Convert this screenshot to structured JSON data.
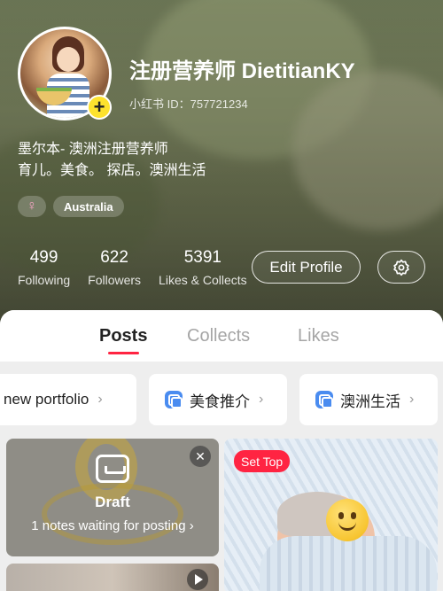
{
  "profile": {
    "nickname": "注册营养师 DietitianKY",
    "user_id": "小红书 ID：757721234",
    "bio_line1": "墨尔本- 澳洲注册营养师",
    "bio_line2": "育儿。美食。 探店。澳洲生活",
    "gender_icon": "♀",
    "location_tag": "Australia",
    "plus_icon": "+"
  },
  "stats": [
    {
      "value": "499",
      "label": "Following"
    },
    {
      "value": "622",
      "label": "Followers"
    },
    {
      "value": "5391",
      "label": "Likes & Collects"
    }
  ],
  "actions": {
    "edit_profile": "Edit Profile",
    "settings_icon": "gear-icon"
  },
  "tabs": [
    {
      "label": "Posts",
      "active": true
    },
    {
      "label": "Collects",
      "active": false
    },
    {
      "label": "Likes",
      "active": false
    }
  ],
  "collections": [
    {
      "label": "new portfolio"
    },
    {
      "label": "美食推介"
    },
    {
      "label": "澳洲生活"
    }
  ],
  "chevron": "›",
  "draft": {
    "title": "Draft",
    "subtitle": "1 notes waiting for posting ›",
    "close": "✕"
  },
  "pinned": {
    "badge": "Set Top"
  },
  "colors": {
    "accent": "#ff2442",
    "badge_yellow": "#fde22e",
    "collection_icon": "#4a8cf0"
  }
}
